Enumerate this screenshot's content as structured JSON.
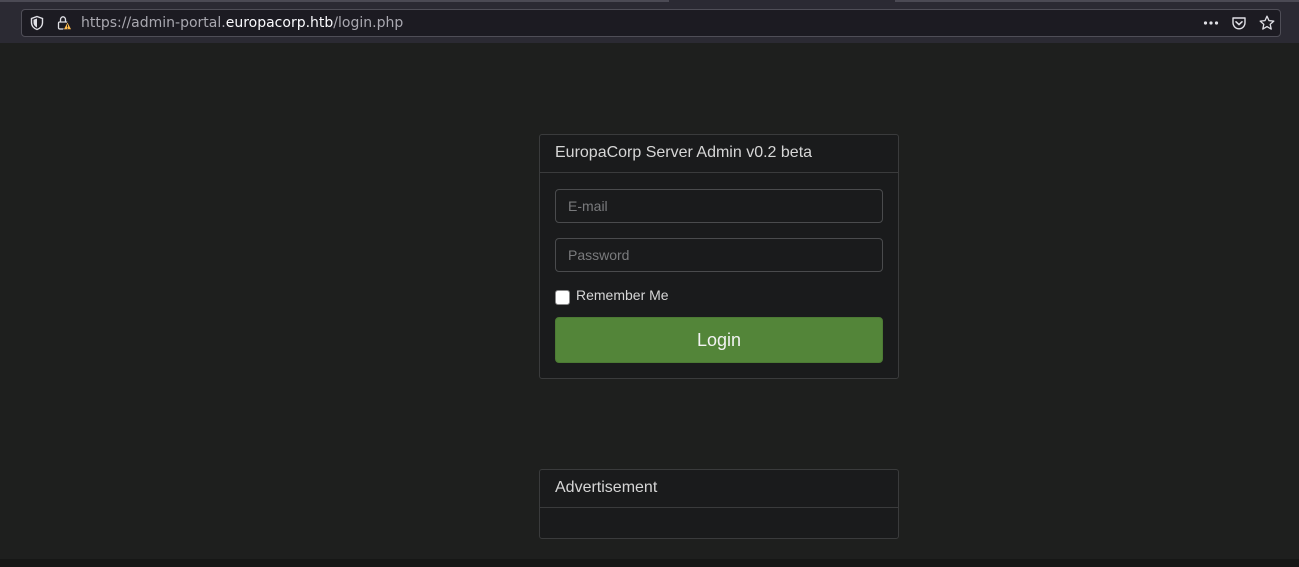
{
  "browser": {
    "url_prefix": "https://admin-portal.",
    "url_domain": "europacorp.htb",
    "url_path": "/login.php",
    "icons": [
      "shield-icon",
      "insecure-lock-icon",
      "more-icon",
      "pocket-icon",
      "bookmark-star-icon"
    ]
  },
  "login": {
    "title": "EuropaCorp Server Admin v0.2 beta",
    "email_placeholder": "E-mail",
    "password_placeholder": "Password",
    "remember_label": "Remember Me",
    "submit_label": "Login"
  },
  "ad": {
    "title": "Advertisement"
  },
  "colors": {
    "page_bg": "#1e1f1e",
    "button_green": "#538539",
    "panel_bg": "#1a1b1c"
  }
}
